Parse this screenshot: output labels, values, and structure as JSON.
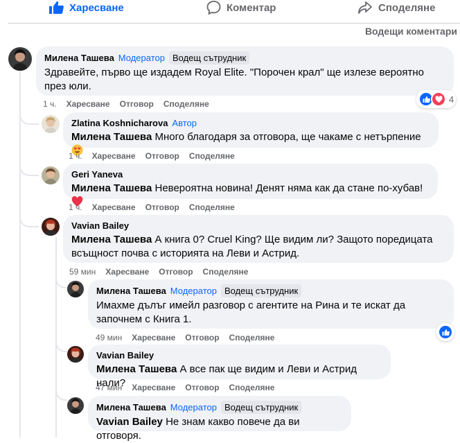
{
  "actions": {
    "like": "Харесване",
    "comment": "Коментар",
    "share": "Споделяне"
  },
  "sort_label": "Водещи коментари",
  "comments": [
    {
      "author": "Милена Ташева",
      "role": "Модератор",
      "badge": "Водещ сътрудник",
      "text": "Здравейте, първо ще издадем Royal Elite. \"Порочен крал\" ще излезе вероятно през юли.",
      "time": "1 ч.",
      "reactions_count": "4",
      "replies": [
        {
          "author": "Zlatina Koshnicharova",
          "role": "Автор",
          "mention": "Милена Ташева",
          "text": "Много благодаря за отговора, ще чакаме с нетърпение",
          "time": "1 ч."
        },
        {
          "author": "Geri Yaneva",
          "mention": "Милена Ташева",
          "text": "Невероятна новина! Денят няма как да стане по-хубав!",
          "time": "1 ч."
        },
        {
          "author": "Vavian Bailey",
          "mention": "Милена Ташева",
          "text": "А книга 0? Cruel King? Ще видим ли? Защото поредицата всъщност почва с историята на Леви и Астрид.",
          "time": "59 мин",
          "replies": [
            {
              "author": "Милена Ташева",
              "role": "Модератор",
              "badge": "Водещ сътрудник",
              "text": "Имахме дълъг имейл разговор с агентите на Рина и те искат да започнем с Книга 1.",
              "time": "49 мин"
            },
            {
              "author": "Vavian Bailey",
              "mention": "Милена Ташева",
              "text": "А все пак ще видим и Леви и Астрид нали?",
              "time": "47 мин"
            },
            {
              "author": "Милена Ташева",
              "role": "Модератор",
              "badge": "Водещ сътрудник",
              "mention": "Vavian Bailey",
              "text": "Не знам какво повече да ви отговоря."
            }
          ]
        }
      ]
    }
  ],
  "meta_actions": {
    "like": "Харесване",
    "reply": "Отговор",
    "share": "Споделяне"
  },
  "colors": {
    "accent": "#0866ff",
    "bubble": "#f0f2f5",
    "muted": "#65676b",
    "love": "#f33e58"
  },
  "icons": [
    "thumbs-up-icon",
    "comment-icon",
    "share-icon",
    "heart-emoji",
    "heart-eyes-emoji"
  ]
}
